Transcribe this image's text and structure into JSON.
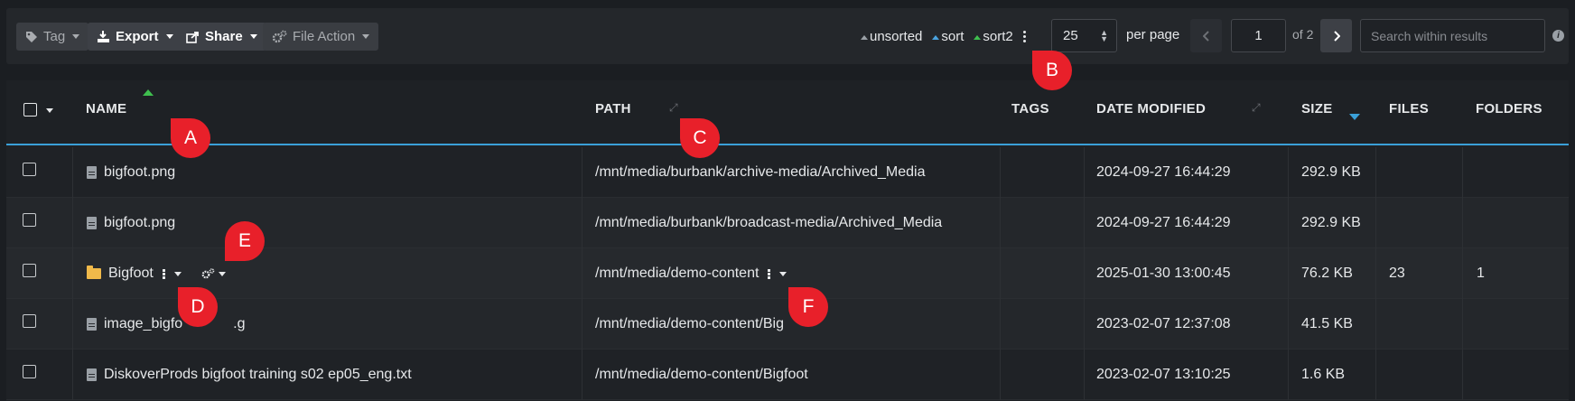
{
  "toolbar": {
    "tag_label": "Tag",
    "export_label": "Export",
    "share_label": "Share",
    "file_action_label": "File Action",
    "sort_options": [
      "unsorted",
      "sort",
      "sort2"
    ],
    "per_page_value": "25",
    "per_page_label": "per page",
    "current_page": "1",
    "of_pages": "of 2",
    "search_placeholder": "Search within results"
  },
  "table": {
    "columns": {
      "name": "NAME",
      "path": "PATH",
      "tags": "TAGS",
      "date_modified": "DATE MODIFIED",
      "size": "SIZE",
      "files": "FILES",
      "folders": "FOLDERS"
    },
    "rows": [
      {
        "type": "file",
        "name": "bigfoot.png",
        "path": "/mnt/media/burbank/archive-media/Archived_Media",
        "date": "2024-09-27 16:44:29",
        "size": "292.9 KB",
        "files": "",
        "folders": ""
      },
      {
        "type": "file",
        "name": "bigfoot.png",
        "path": "/mnt/media/burbank/broadcast-media/Archived_Media",
        "date": "2024-09-27 16:44:29",
        "size": "292.9 KB",
        "files": "",
        "folders": ""
      },
      {
        "type": "folder",
        "name": "Bigfoot",
        "path": "/mnt/media/demo-content",
        "date": "2025-01-30 13:00:45",
        "size": "76.2 KB",
        "files": "23",
        "folders": "1"
      },
      {
        "type": "file",
        "name": "image_bigfo",
        "name_tail": ".g",
        "path": "/mnt/media/demo-content/Big",
        "date": "2023-02-07 12:37:08",
        "size": "41.5 KB",
        "files": "",
        "folders": ""
      },
      {
        "type": "file",
        "name": "DiskoverProds bigfoot training s02 ep05_eng.txt",
        "path": "/mnt/media/demo-content/Bigfoot",
        "date": "2023-02-07 13:10:25",
        "size": "1.6 KB",
        "files": "",
        "folders": ""
      }
    ]
  },
  "markers": {
    "a": "A",
    "b": "B",
    "c": "C",
    "d": "D",
    "e": "E",
    "f": "F"
  },
  "colors": {
    "accent_blue": "#3aa0d8",
    "sort_green": "#3fbf4f",
    "marker_red": "#e8202a",
    "folder": "#f0b94a"
  },
  "icons": [
    "tag-icon",
    "export-icon",
    "share-icon",
    "gears-icon",
    "kebab-icon",
    "chevron-left-icon",
    "chevron-right-icon",
    "info-icon",
    "file-icon",
    "folder-icon",
    "expand-icon"
  ]
}
